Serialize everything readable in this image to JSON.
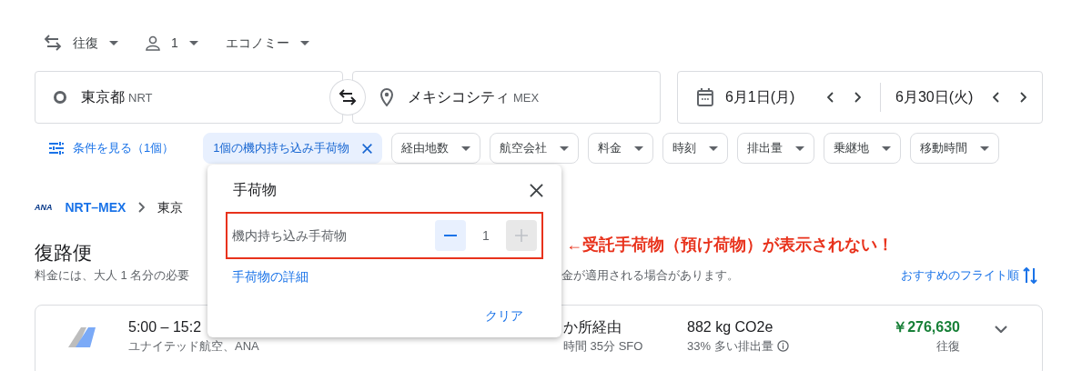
{
  "trip_options": [
    {
      "kind": "trip",
      "label": "往復"
    },
    {
      "kind": "passengers",
      "label": "1"
    },
    {
      "kind": "class",
      "label": "エコノミー"
    }
  ],
  "search": {
    "origin": {
      "city": "東京都",
      "code": "NRT"
    },
    "destination": {
      "city": "メキシコシティ",
      "code": "MEX"
    },
    "dates": [
      {
        "label": "6月1日(月)"
      },
      {
        "label": "6月30日(火)"
      }
    ]
  },
  "filters": {
    "all_filters": "条件を見る（1個）",
    "chips": [
      {
        "kind": "active",
        "label": "1個の機内持ち込み手荷物"
      },
      {
        "kind": "dropdown",
        "label": "経由地数"
      },
      {
        "kind": "dropdown",
        "label": "航空会社"
      },
      {
        "kind": "dropdown",
        "label": "料金"
      },
      {
        "kind": "dropdown",
        "label": "時刻"
      },
      {
        "kind": "dropdown",
        "label": "排出量"
      },
      {
        "kind": "dropdown",
        "label": "乗継地"
      },
      {
        "kind": "dropdown",
        "label": "移動時間"
      }
    ]
  },
  "breadcrumb": {
    "logo": "ANA",
    "route": "NRT–MEX",
    "destination": "東京"
  },
  "results": {
    "title": "復路便",
    "note_left": "料金には、大人 1 名分の必要",
    "note_right": "金が適用される場合があります。",
    "sort": "おすすめのフライト順"
  },
  "flight": {
    "times": "5:00 – 15:2",
    "airline": "ユナイテッド航空、ANA",
    "stops": "か所経由",
    "duration": "時間 35分 SFO",
    "emissions": "882 kg CO2e",
    "emissions_note": "33% 多い排出量",
    "price": "￥276,630",
    "price_note": "往復"
  },
  "bag_popup": {
    "title": "手荷物",
    "items": [
      {
        "label": "機内持ち込み手荷物",
        "value": "1",
        "can_decrease": true,
        "can_increase": false
      }
    ],
    "details_link": "手荷物の詳細",
    "clear": "クリア"
  },
  "annotation": "←受託手荷物（預け荷物）が表示されない！"
}
